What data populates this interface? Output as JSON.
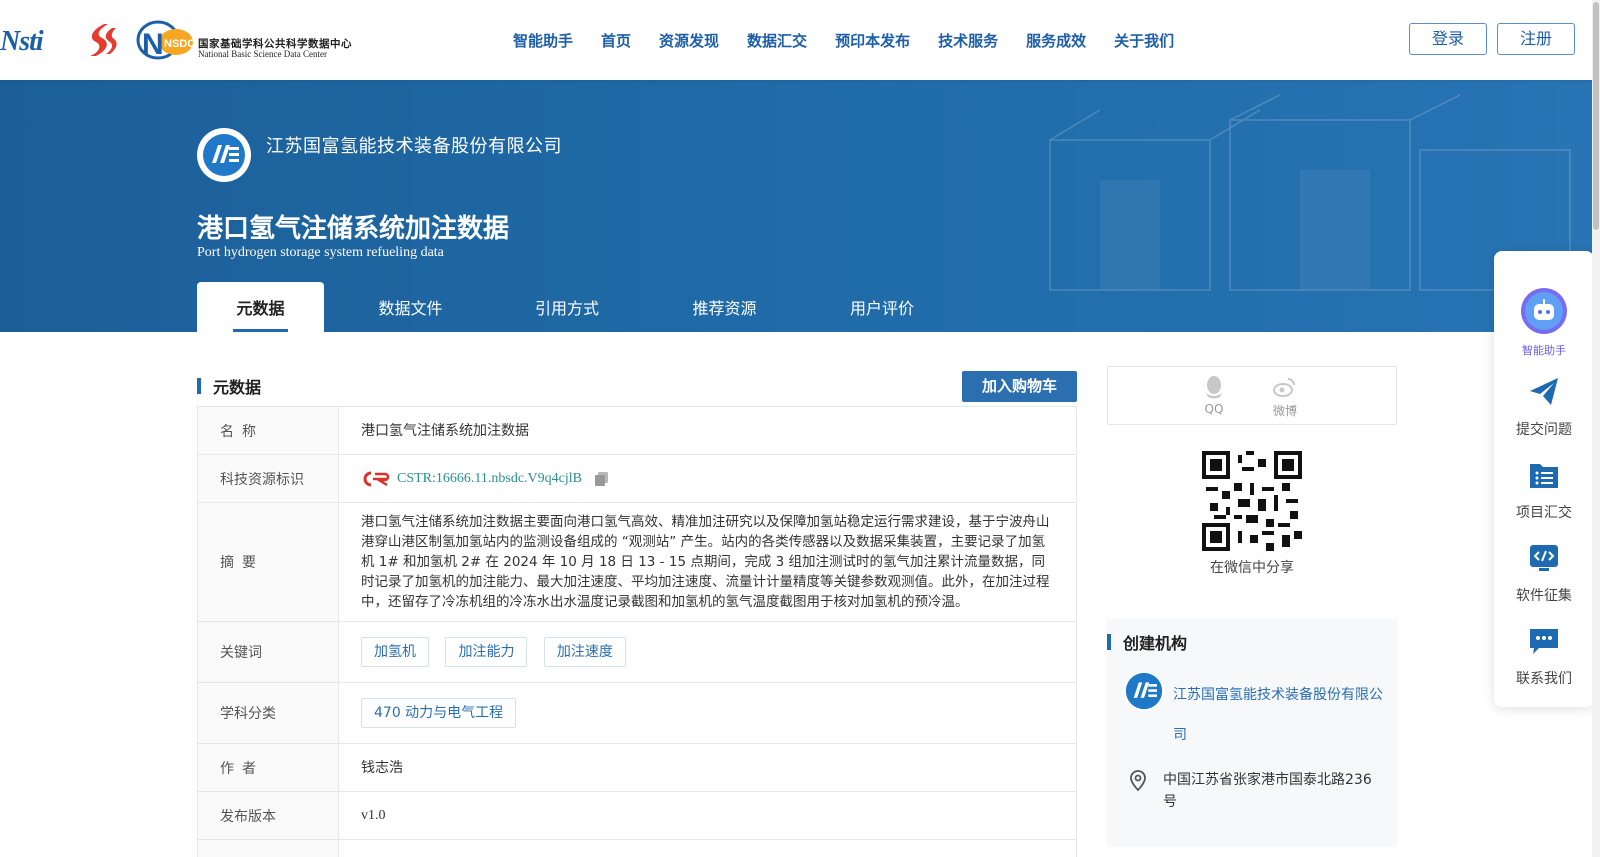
{
  "header": {
    "logo_nsti": "Nsti",
    "logo_nsdc_abbr": "NSDC",
    "logo_nsdc_cn": "国家基础学科公共科学数据中心",
    "logo_nsdc_en": "National Basic Science Data Center",
    "nav": [
      "智能助手",
      "首页",
      "资源发现",
      "数据汇交",
      "预印本发布",
      "技术服务",
      "服务成效",
      "关于我们"
    ],
    "login_label": "登录",
    "register_label": "注册"
  },
  "banner": {
    "org_name": "江苏国富氢能技术装备股份有限公司",
    "title_cn": "港口氢气注储系统加注数据",
    "title_en": "Port hydrogen storage system refueling data",
    "tabs": [
      "元数据",
      "数据文件",
      "引用方式",
      "推荐资源",
      "用户评价"
    ],
    "active_tab": 0
  },
  "main": {
    "section_title": "元数据",
    "cart_button": "加入购物车",
    "rows": {
      "name_key": "名称",
      "name_val": "港口氢气注储系统加注数据",
      "cstr_key": "科技资源标识",
      "cstr_val": "CSTR:16666.11.nbsdc.V9q4cjlB",
      "abstract_key": "摘要",
      "abstract_val": "港口氢气注储系统加注数据主要面向港口氢气高效、精准加注研究以及保障加氢站稳定运行需求建设，基于宁波舟山港穿山港区制氢加氢站内的监测设备组成的 “观测站” 产生。站内的各类传感器以及数据采集装置，主要记录了加氢机 1# 和加氢机 2# 在 2024 年 10 月 18 日 13 - 15 点期间，完成 3 组加注测试时的氢气加注累计流量数据，同时记录了加氢机的加注能力、最大加注速度、平均加注速度、流量计计量精度等关键参数观测值。此外，在加注过程中，还留存了冷冻机组的冷冻水出水温度记录截图和加氢机的氢气温度截图用于核对加氢机的预冷温。",
      "keywords_key": "关键词",
      "keywords": [
        "加氢机",
        "加注能力",
        "加注速度"
      ],
      "subject_key": "学科分类",
      "subject_val": "470 动力与电气工程",
      "author_key": "作者",
      "author_val": "钱志浩",
      "version_key": "发布版本",
      "version_val": "v1.0"
    }
  },
  "sidebar_right": {
    "share_qq": "QQ",
    "share_weibo": "微博",
    "qr_caption": "在微信中分享",
    "org_title": "创建机构",
    "org_name": "江苏国富氢能技术装备股份有限公司",
    "org_address": "中国江苏省张家港市国泰北路236号"
  },
  "float_menu": {
    "items": [
      "智能助手",
      "提交问题",
      "项目汇交",
      "软件征集",
      "联系我们"
    ]
  },
  "colors": {
    "primary": "#1e6ab0",
    "banner": "#1f6aa7",
    "cstr_text": "#2a8f8f",
    "assistant_purple": "#6c5ce7"
  }
}
